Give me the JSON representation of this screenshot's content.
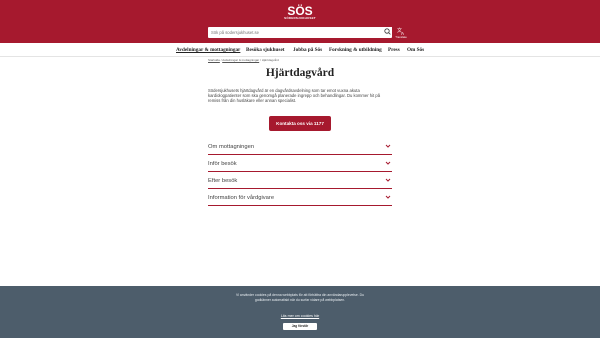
{
  "header": {
    "logo_text": "SÖDERSJUKHUSET",
    "logo_icon": "sos-logo",
    "search_placeholder": "Sök på sodersjukhuset.se",
    "search_label": "Sök",
    "translate_label": "Translate",
    "brand_color": "#a6192e"
  },
  "nav": {
    "items": [
      {
        "label": "Avdelningar & mottagningar",
        "active": true
      },
      {
        "label": "Besöka sjukhuset"
      },
      {
        "label": "Jobba på Sös"
      },
      {
        "label": "Forskning & utbildning"
      },
      {
        "label": "Press"
      },
      {
        "label": "Om Sös"
      }
    ]
  },
  "breadcrumb": {
    "items": [
      "Startsida",
      "Avdelningar & mottagningar",
      "Hjärtdagvård"
    ]
  },
  "main": {
    "title": "Hjärtdagvård",
    "intro": "Södersjukhusets hjärtdagvård är en dagvårdsavdelning som tar emot vuxna akuta kardiologpatienter som ska genomgå planerade ingrepp och behandlingar. Du kommer hit på remiss från din husläkare eller annan specialist.",
    "cta_label": "Kontakta oss via 1177",
    "accordions": [
      {
        "label": "Om mottagningen"
      },
      {
        "label": "Inför besök"
      },
      {
        "label": "Efter besök"
      },
      {
        "label": "Information för vårdgivare"
      }
    ]
  },
  "cookie": {
    "text": "Vi använder cookies på denna webbplats för att förbättra din användarupplevelse. Du godkänner automatiskt när du surfar vidare på webbplatsen.",
    "link_label": "Läs mer om cookies här",
    "button_label": "Jag förstår",
    "bg_color": "#4d5d6b"
  }
}
